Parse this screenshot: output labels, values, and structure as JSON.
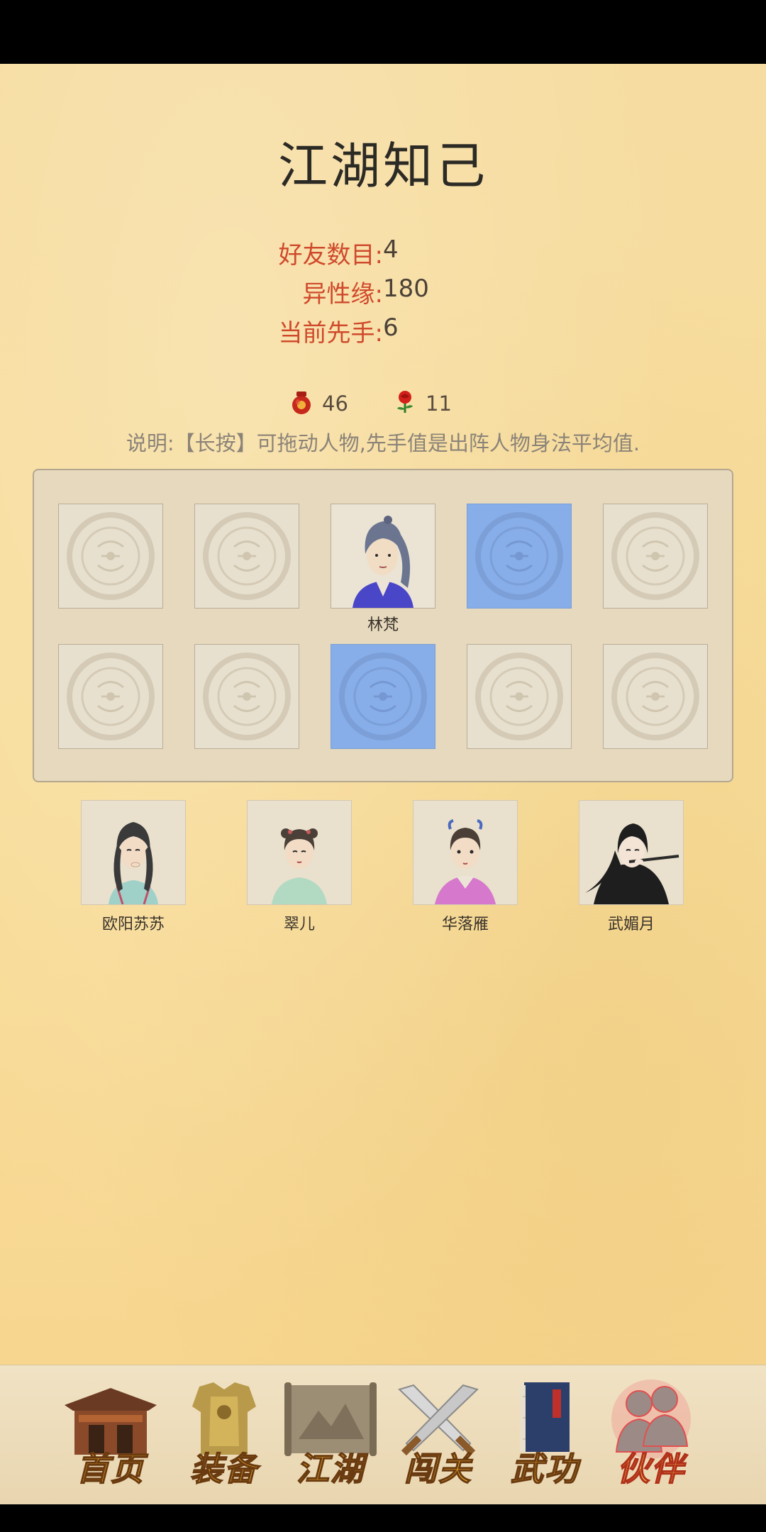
{
  "title": "江湖知己",
  "stats": [
    {
      "label": "好友数目:",
      "value": "4"
    },
    {
      "label": "异性缘:",
      "value": "180"
    },
    {
      "label": "当前先手:",
      "value": "6"
    }
  ],
  "resources": [
    {
      "icon": "wine-jar-icon",
      "value": "46"
    },
    {
      "icon": "rose-icon",
      "value": "11"
    }
  ],
  "note": "说明:【长按】可拖动人物,先手值是出阵人物身法平均值.",
  "lineup": {
    "row1": [
      {
        "state": "empty",
        "name": ""
      },
      {
        "state": "empty",
        "name": ""
      },
      {
        "state": "character",
        "name": "林梵"
      },
      {
        "state": "selected",
        "name": ""
      },
      {
        "state": "empty",
        "name": ""
      }
    ],
    "row2": [
      {
        "state": "empty",
        "name": ""
      },
      {
        "state": "empty",
        "name": ""
      },
      {
        "state": "selected",
        "name": ""
      },
      {
        "state": "empty",
        "name": ""
      },
      {
        "state": "empty",
        "name": ""
      }
    ]
  },
  "reserve": [
    {
      "name": "欧阳苏苏"
    },
    {
      "name": "翠儿"
    },
    {
      "name": "华落雁"
    },
    {
      "name": "武媚月"
    }
  ],
  "tabs": [
    {
      "label": "首页",
      "icon": "house-icon",
      "active": false
    },
    {
      "label": "装备",
      "icon": "armor-icon",
      "active": false
    },
    {
      "label": "江湖",
      "icon": "scroll-map-icon",
      "active": false
    },
    {
      "label": "闯关",
      "icon": "swords-icon",
      "active": false
    },
    {
      "label": "武功",
      "icon": "book-icon",
      "active": false
    },
    {
      "label": "伙伴",
      "icon": "partners-icon",
      "active": true
    }
  ]
}
